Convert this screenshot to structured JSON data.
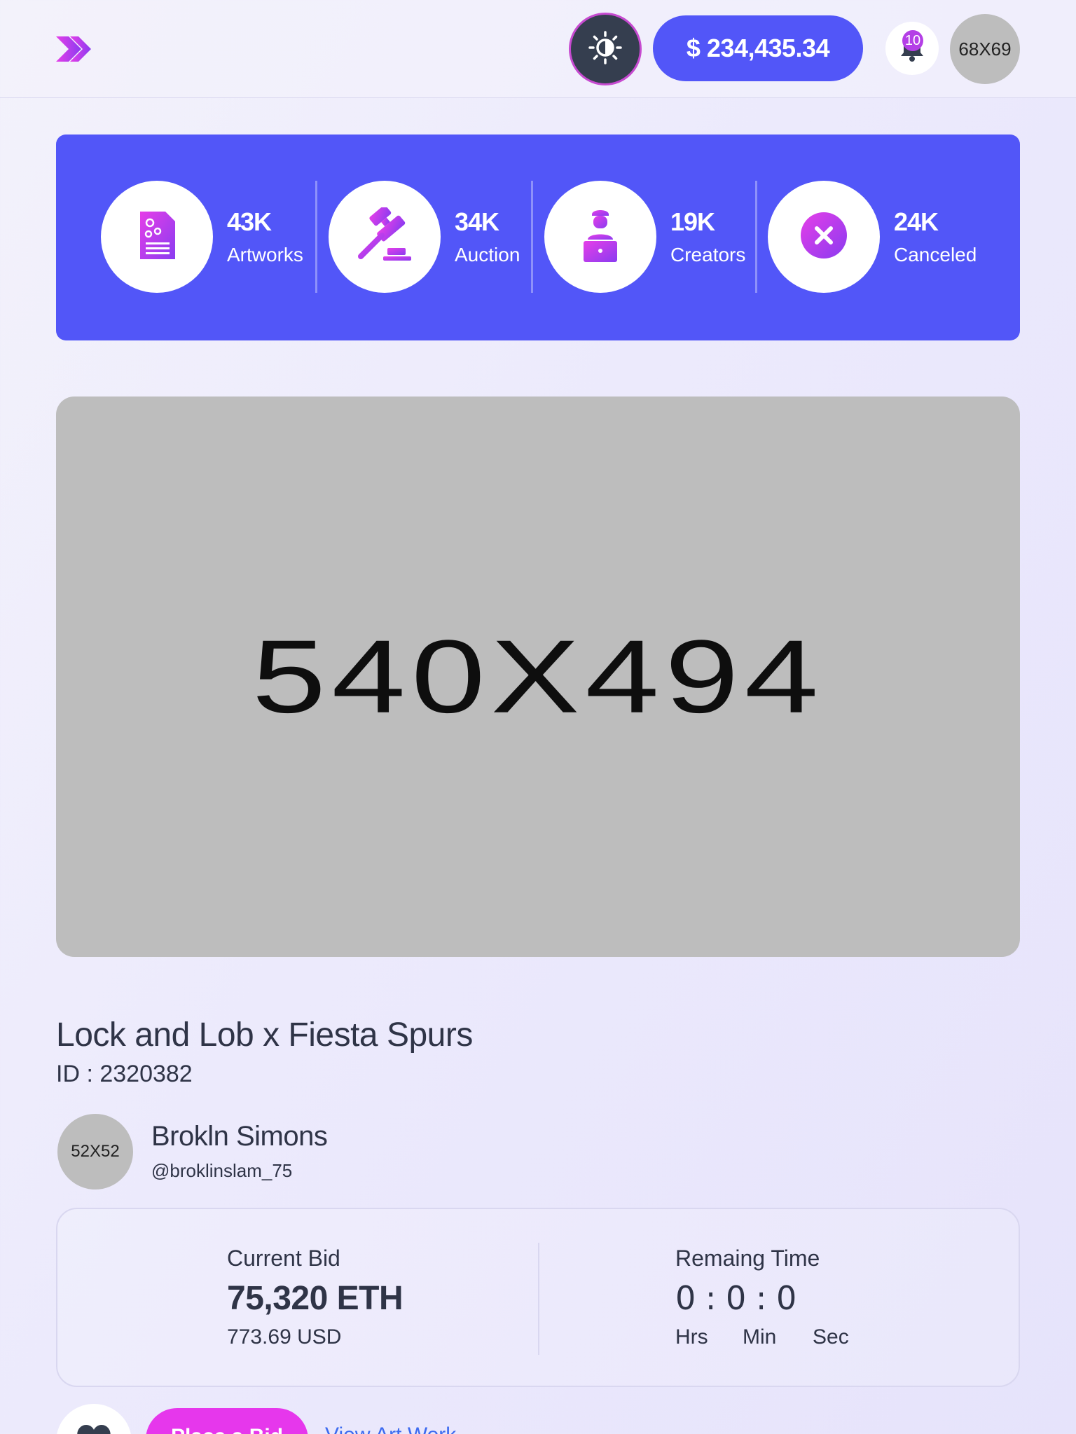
{
  "header": {
    "balance": "$ 234,435.34",
    "notifications_count": "10",
    "avatar_placeholder": "68X69",
    "icons": {
      "logo": "double-chevron-right-icon",
      "theme": "sun-icon",
      "bell": "bell-icon"
    }
  },
  "stats": [
    {
      "value": "43K",
      "label": "Artworks",
      "icon": "document-gear-icon"
    },
    {
      "value": "34K",
      "label": "Auction",
      "icon": "gavel-icon"
    },
    {
      "value": "19K",
      "label": "Creators",
      "icon": "creator-laptop-icon"
    },
    {
      "value": "24K",
      "label": "Canceled",
      "icon": "cancel-circle-icon"
    }
  ],
  "artwork": {
    "placeholder": "540X494"
  },
  "item": {
    "title": "Lock and Lob x Fiesta Spurs",
    "id": "ID : 2320382"
  },
  "creator": {
    "avatar_placeholder": "52X52",
    "name": "Brokln Simons",
    "handle": "@broklinslam_75"
  },
  "bid": {
    "current_label": "Current Bid",
    "current_value": "75,320 ETH",
    "current_usd": "773.69 USD",
    "time_label": "Remaing Time",
    "time_value": "0 : 0 : 0",
    "time_units": [
      "Hrs",
      "Min",
      "Sec"
    ]
  },
  "actions": {
    "place_bid": "Place a Bid",
    "view_activity": "View Art Work"
  },
  "colors": {
    "accent": "#5256f8",
    "pink": "#e637ec",
    "icon_gradient_start": "#e63ee8",
    "icon_gradient_end": "#8a3cf0",
    "text": "#2f3447",
    "placeholder": "#bdbdbd"
  }
}
